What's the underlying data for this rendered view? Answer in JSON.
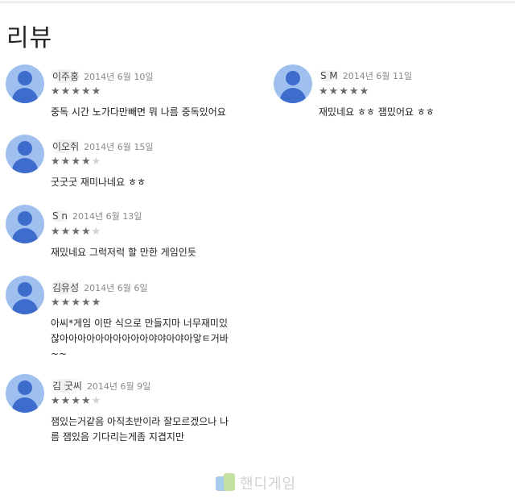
{
  "page": {
    "title": "리뷰"
  },
  "reviews": [
    {
      "author": "이주홍",
      "date": "2014년 6월 10일",
      "rating": 5,
      "text": "중독 시간 노가다만빼면 뭐 나름 중독있어요"
    },
    {
      "author": "S      M",
      "date": "2014년 6월 11일",
      "rating": 5,
      "text": "재밌네요 ㅎㅎ 잼밌어요 ㅎㅎ"
    },
    {
      "author": "이오쥐",
      "date": "2014년 6월 15일",
      "rating": 4,
      "text": "굿굿굿 재미나네요 ㅎㅎ"
    },
    {
      "author": "S        n",
      "date": "2014년 6월 13일",
      "rating": 4,
      "text": "재밌네요 그럭저럭 할 만한 게임인듯"
    },
    {
      "author": "김유성",
      "date": "2014년 6월 6일",
      "rating": 5,
      "text": "아씨*게임 이딴 식으로 만들지마 너무재미있\n잖아아아아아아아아아아야야아야아앟ㅌ거바\n~~"
    },
    {
      "author": "김        굿씨",
      "date": "2014년 6월 9일",
      "rating": 4,
      "text": "잼있는거같음 아직초반이라 잘모르겠으나 나\n름 잼있음 기다리는게좀 지겹지만"
    }
  ],
  "watermark": {
    "text": "핸디게임"
  }
}
